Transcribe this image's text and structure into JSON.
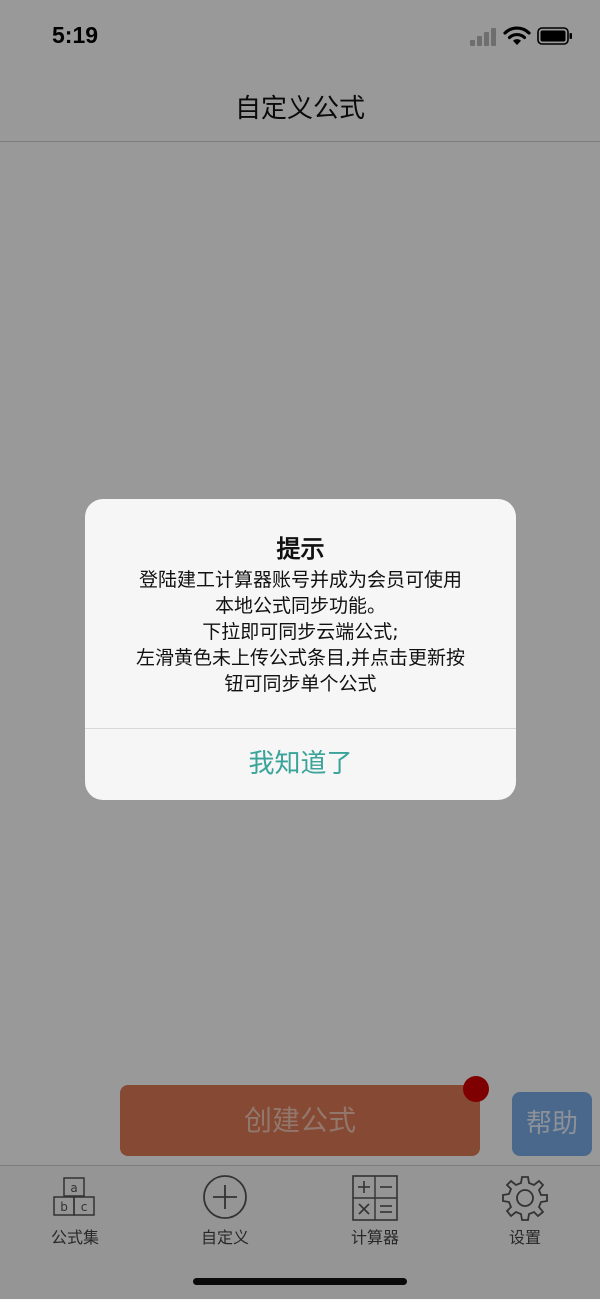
{
  "status_bar": {
    "time": "5:19"
  },
  "nav": {
    "title": "自定义公式"
  },
  "actions": {
    "create_label": "创建公式",
    "help_label": "帮助"
  },
  "tabs": [
    {
      "label": "公式集",
      "icon": "abc-blocks-icon"
    },
    {
      "label": "自定义",
      "icon": "plus-circle-icon"
    },
    {
      "label": "计算器",
      "icon": "calculator-icon"
    },
    {
      "label": "设置",
      "icon": "gear-icon"
    }
  ],
  "alert": {
    "title": "提示",
    "message_lines": [
      "登陆建工计算器账号并成为会员可使用",
      "本地公式同步功能。",
      "下拉即可同步云端公式;",
      "左滑黄色未上传公式条目,并点击更新按",
      "钮可同步单个公式"
    ],
    "button_label": "我知道了"
  },
  "colors": {
    "create_button": "#e07a55",
    "help_button": "#7aaeea",
    "badge": "#d40000",
    "alert_button_text": "#3aa39a"
  }
}
